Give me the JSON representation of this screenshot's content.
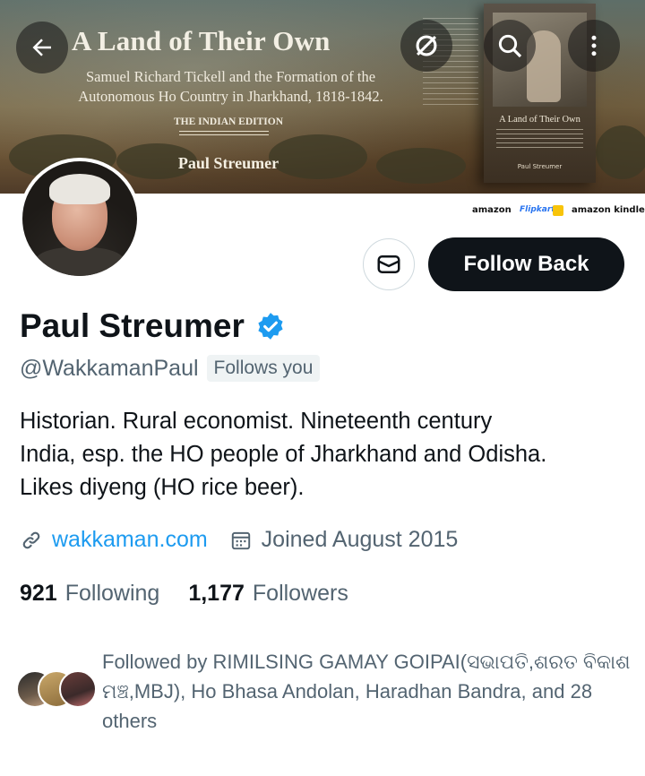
{
  "banner": {
    "title": "A Land of Their Own",
    "subtitle_line1": "Samuel Richard Tickell and the Formation of the",
    "subtitle_line2": "Autonomous Ho Country in Jharkhand, 1818-1842.",
    "edition": "THE INDIAN EDITION",
    "author": "Paul Streumer",
    "book_title": "A Land of Their Own",
    "book_author": "Paul Streumer",
    "stores": [
      "amazon",
      "Flipkart",
      "amazon kindle"
    ]
  },
  "nav": {
    "back_icon": "arrow-left-icon",
    "hide_icon": "slash-circle-icon",
    "search_icon": "search-icon",
    "more_icon": "more-vertical-icon"
  },
  "actions": {
    "message_icon": "envelope-icon",
    "follow_back_label": "Follow Back"
  },
  "profile": {
    "name": "Paul Streumer",
    "handle": "@WakkamanPaul",
    "follows_you": "Follows you",
    "bio_line1": "Historian. Rural economist. Nineteenth century",
    "bio_line2": "India, esp. the HO people of Jharkhand and Odisha.",
    "bio_line3": "Likes diyeng (HO rice beer).",
    "website": "wakkaman.com",
    "joined": "Joined August 2015"
  },
  "stats": {
    "following_count": "921",
    "following_label": "Following",
    "followers_count": "1,177",
    "followers_label": "Followers"
  },
  "followed_by": {
    "text": "Followed by RIMILSING GAMAY GOIPAI(ସଭାପତି,ଶରତ ବିକାଶ ମଞ୍ଚ,MBJ), Ho Bhasa Andolan, Haradhan Bandra, and 28 others"
  },
  "colors": {
    "primary_text": "#0f1419",
    "secondary_text": "#536471",
    "link": "#1d9bf0",
    "verified": "#1d9bf0",
    "button_dark": "#0f1419"
  }
}
